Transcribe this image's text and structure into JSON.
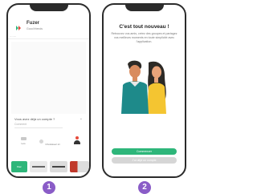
{
  "colors": {
    "accent": "#2eb67a",
    "step_badge": "#8a5cc7",
    "phone_frame": "#2b2b2b"
  },
  "screen1": {
    "brand_name": "Fuzer",
    "brand_subtitle": "Good friends",
    "header_link": "·······",
    "question": "Vous avez déjà un compte ?",
    "field_placeholder": "Comment",
    "options": [
      {
        "label": "Léo"
      },
      {
        "label": "Choisissez ici"
      },
      {
        "label": ""
      }
    ],
    "tiles": [
      {
        "label": "Fuz"
      },
      {
        "label": ""
      },
      {
        "label": ""
      },
      {
        "label": ""
      }
    ]
  },
  "screen2": {
    "title": "C'est tout nouveau !",
    "description": "Retrouvez vos amis, créez des groupes et partagez vos meilleurs moments en toute simplicité avec l'application.",
    "primary_button": "Commencer",
    "secondary_button": "J'ai déjà un compte"
  },
  "steps": [
    "1",
    "2"
  ]
}
